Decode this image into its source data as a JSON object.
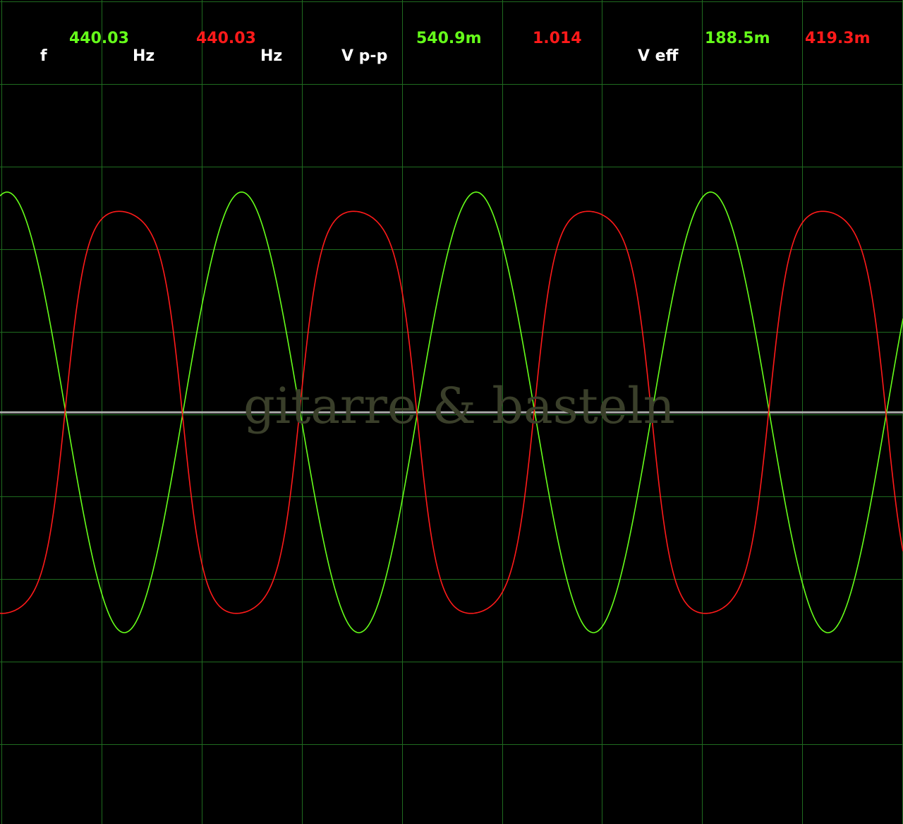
{
  "readouts": {
    "freq_label": "f",
    "freq_ch1_value": "440.03",
    "freq_ch1_unit": "Hz",
    "freq_ch2_value": "440.03",
    "freq_ch2_unit": "Hz",
    "vpp_label": "V p-p",
    "vpp_ch1_value": "540.9m",
    "vpp_ch2_value": "1.014",
    "veff_label": "V eff",
    "veff_ch1_value": "188.5m",
    "veff_ch2_value": "419.3m"
  },
  "watermark": "gitarre & basteln",
  "colors": {
    "background": "#000000",
    "grid": "#1f6b1f",
    "ch1": "#66ff1a",
    "ch2": "#ff1a1a",
    "baseline": "#a9a9a9",
    "label": "#ffffff"
  },
  "chart_data": {
    "type": "line",
    "title": "",
    "xlabel": "",
    "ylabel": "",
    "grid": true,
    "divisions_x": 9,
    "divisions_y": 10,
    "x_unit": "periods",
    "x_range": [
      0,
      3.85
    ],
    "ylim": [
      -1.25,
      1.25
    ],
    "series": [
      {
        "color": "#66ff1a",
        "shape": "sine",
        "frequency_hz": 440.03,
        "amplitude_rel": 1.0,
        "phase_periods": 0.22
      },
      {
        "color": "#ff1a1a",
        "shape": "clipped-sine",
        "frequency_hz": 440.03,
        "amplitude_rel": 0.93,
        "clip_level": 0.78,
        "phase_periods": 0.72
      }
    ]
  }
}
